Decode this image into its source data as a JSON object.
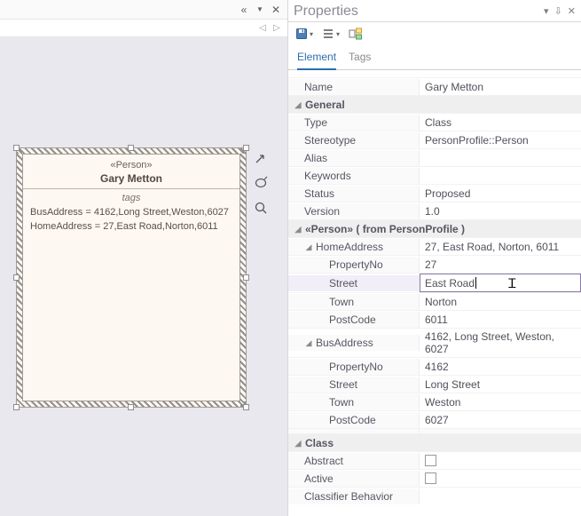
{
  "left": {
    "stereotype": "«Person»",
    "name": "Gary Metton",
    "tags_title": "tags",
    "tag_lines": [
      "BusAddress = 4162,Long Street,Weston,6027",
      "HomeAddress = 27,East Road,Norton,6011"
    ]
  },
  "props": {
    "title": "Properties",
    "tabs": {
      "element": "Element",
      "tags": "Tags"
    },
    "name_label": "Name",
    "name_value": "Gary Metton",
    "cat_general": "General",
    "type_label": "Type",
    "type_value": "Class",
    "stereo_label": "Stereotype",
    "stereo_value": "PersonProfile::Person",
    "alias_label": "Alias",
    "alias_value": "",
    "keywords_label": "Keywords",
    "keywords_value": "",
    "status_label": "Status",
    "status_value": "Proposed",
    "version_label": "Version",
    "version_value": "1.0",
    "cat_person": "«Person»  ( from PersonProfile )",
    "home_label": "HomeAddress",
    "home_value": "27, East Road, Norton, 6011",
    "bus_label": "BusAddress",
    "bus_value": "4162, Long Street, Weston, 6027",
    "propno_label": "PropertyNo",
    "street_label": "Street",
    "town_label": "Town",
    "postcode_label": "PostCode",
    "home_propno": "27",
    "home_street": "East Road",
    "home_town": "Norton",
    "home_postcode": "6011",
    "bus_propno": "4162",
    "bus_street": "Long Street",
    "bus_town": "Weston",
    "bus_postcode": "6027",
    "cat_class": "Class",
    "abstract_label": "Abstract",
    "active_label": "Active",
    "classifier_label": "Classifier Behavior"
  }
}
